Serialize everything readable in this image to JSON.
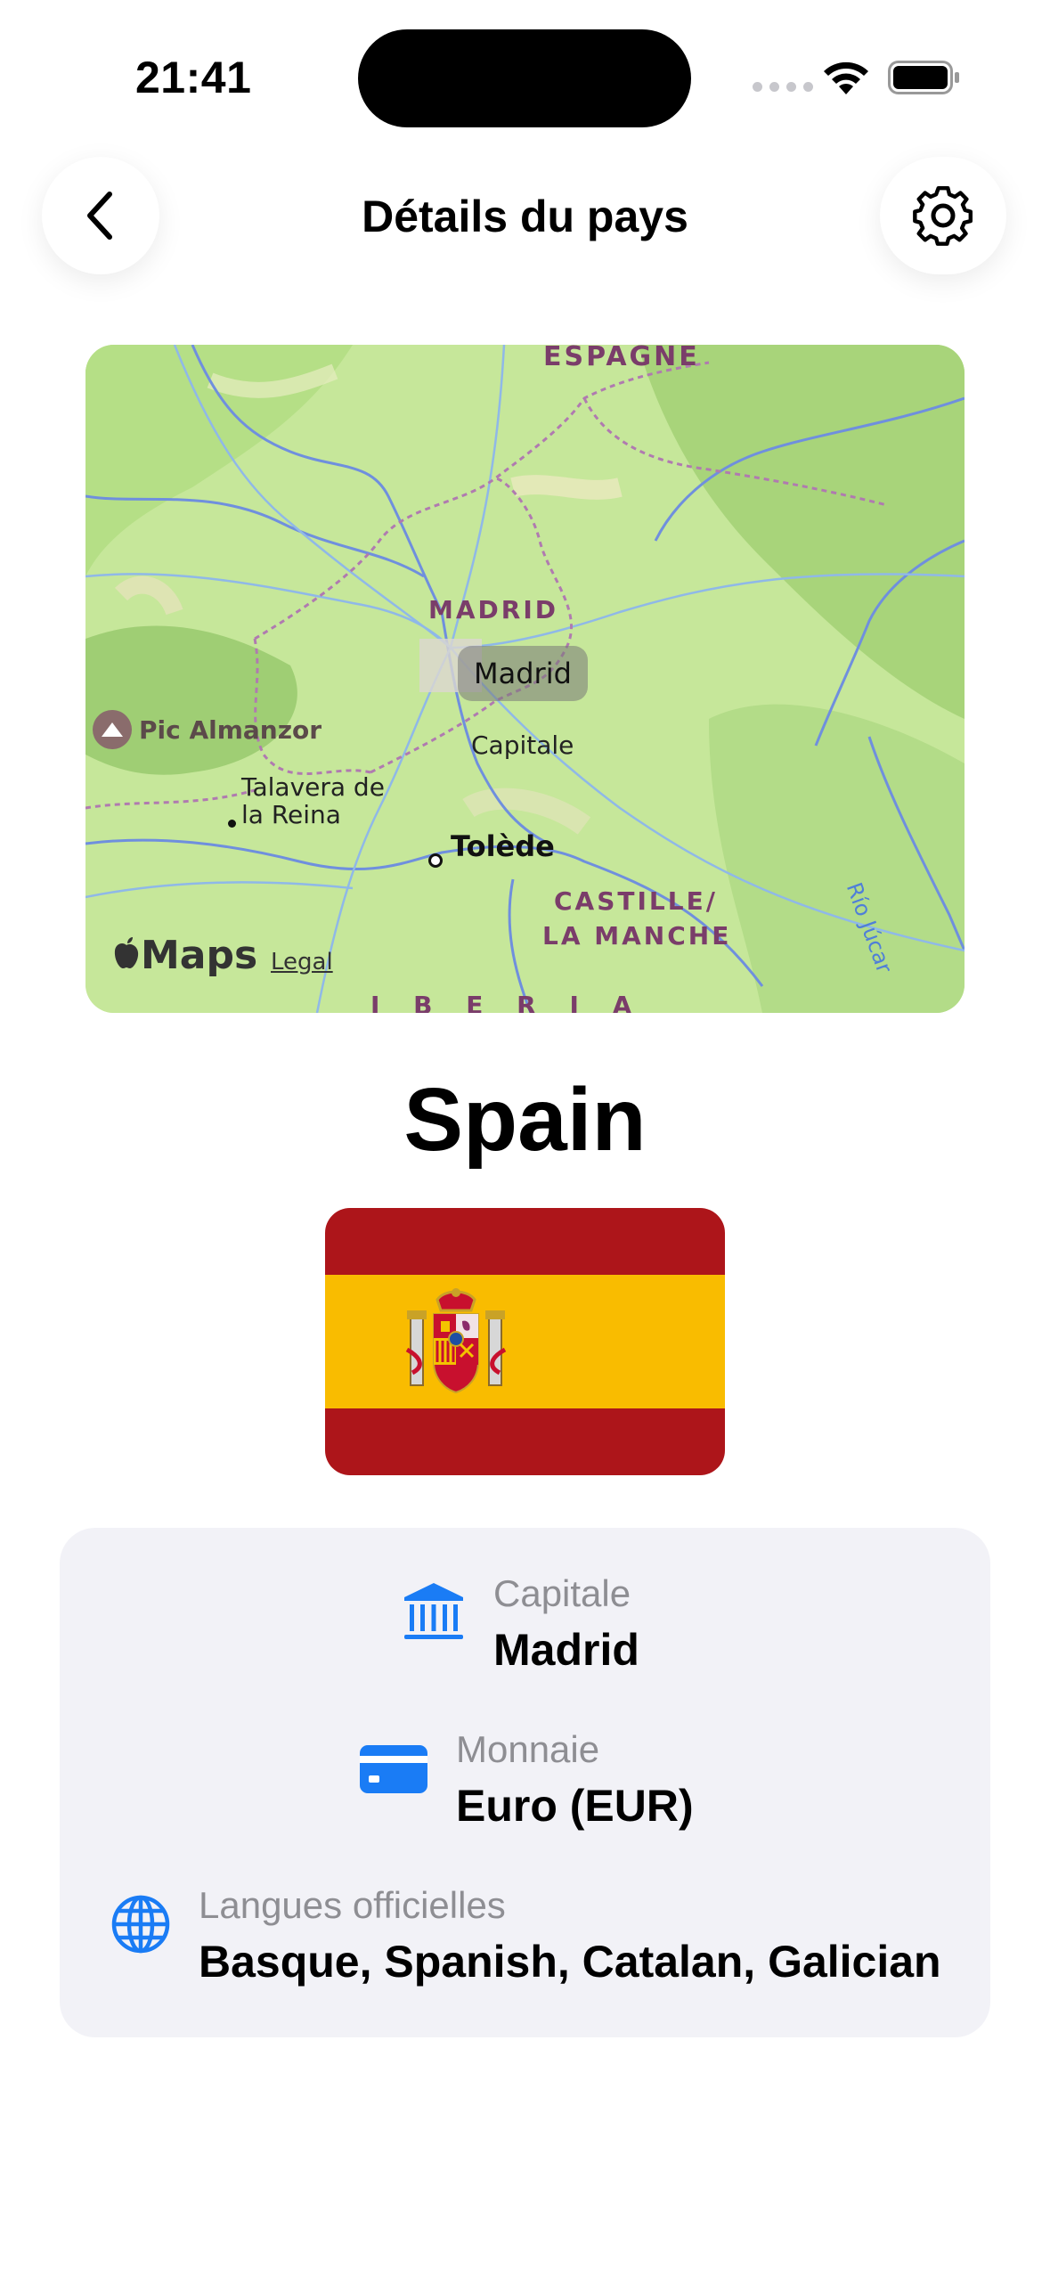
{
  "status_bar": {
    "time": "21:41"
  },
  "nav": {
    "title": "Détails du pays",
    "back_icon": "chevron-left-icon",
    "settings_icon": "gear-icon"
  },
  "map": {
    "region_top": "ESPAGNE",
    "region_madrid": "MADRID",
    "region_castille_1": "CASTILLE/",
    "region_castille_2": "LA MANCHE",
    "pin_label": "Madrid",
    "pin_sublabel": "Capitale",
    "peak": "Pic Almanzor",
    "talavera_1": "Talavera de",
    "talavera_2": "la Reina",
    "toledo": "Tolède",
    "river": "Río Júcar",
    "bottom_partial": "I B E R I A",
    "brand": "Maps",
    "legal": "Legal"
  },
  "country": {
    "name": "Spain",
    "flag_colors": {
      "red": "#ad151a",
      "yellow": "#f9bc00"
    }
  },
  "info": {
    "accent": "#1a7cf5",
    "capital": {
      "icon": "building-columns-icon",
      "label": "Capitale",
      "value": "Madrid"
    },
    "currency": {
      "icon": "credit-card-icon",
      "label": "Monnaie",
      "value": "Euro (EUR)"
    },
    "languages": {
      "icon": "globe-icon",
      "label": "Langues officielles",
      "value": "Basque, Spanish, Catalan, Galician"
    }
  }
}
